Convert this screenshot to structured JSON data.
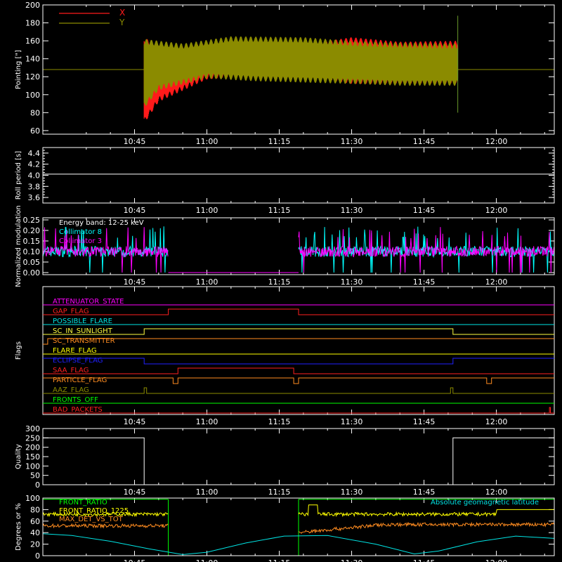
{
  "time_ticks": [
    "10:45",
    "11:00",
    "11:15",
    "11:30",
    "11:45",
    "12:00"
  ],
  "time_tick_minutes": [
    645,
    660,
    675,
    690,
    705,
    720
  ],
  "time_range_minutes": [
    626,
    732
  ],
  "chart_data": [
    {
      "id": "pointing",
      "type": "line",
      "ylabel": "Pointing [\"]",
      "ylim": [
        56,
        200
      ],
      "yticks": [
        60,
        80,
        100,
        120,
        140,
        160,
        180,
        200
      ],
      "legend_placement": "top-left",
      "series": [
        {
          "name": "X",
          "color": "#ff1a1a",
          "envelope_max": [
            [
              647,
              165
            ],
            [
              650,
              150
            ],
            [
              660,
              158
            ],
            [
              670,
              154
            ],
            [
              680,
              156
            ],
            [
              690,
              164
            ],
            [
              700,
              159
            ],
            [
              712,
              160
            ]
          ],
          "envelope_min": [
            [
              647,
              68
            ],
            [
              650,
              92
            ],
            [
              660,
              117
            ],
            [
              670,
              122
            ],
            [
              680,
              120
            ],
            [
              690,
              112
            ],
            [
              700,
              112
            ],
            [
              712,
              112
            ]
          ]
        },
        {
          "name": "Y",
          "color": "#8b8b00",
          "envelope_max": [
            [
              647,
              162
            ],
            [
              655,
              157
            ],
            [
              665,
              165
            ],
            [
              680,
              164
            ],
            [
              690,
              160
            ],
            [
              700,
              158
            ],
            [
              712,
              157
            ]
          ],
          "envelope_min": [
            [
              647,
              85
            ],
            [
              650,
              105
            ],
            [
              660,
              118
            ],
            [
              670,
              115
            ],
            [
              690,
              112
            ],
            [
              700,
              110
            ],
            [
              712,
              110
            ]
          ],
          "baseline": 128
        }
      ]
    },
    {
      "id": "roll",
      "type": "line",
      "ylabel": "Roll period [s]",
      "ylim": [
        3.5,
        4.5
      ],
      "yticks": [
        3.6,
        3.8,
        4.0,
        4.2,
        4.4
      ],
      "series": [
        {
          "color": "#ffffff",
          "values": [
            [
              626,
              4.02
            ],
            [
              732,
              4.02
            ]
          ]
        }
      ]
    },
    {
      "id": "modulation",
      "type": "line",
      "ylabel": "Normalized modulation",
      "ylim": [
        -0.01,
        0.26
      ],
      "yticks": [
        0.0,
        0.05,
        0.1,
        0.15,
        0.2,
        0.25
      ],
      "legend_title": "Energy band: 12-25 keV",
      "series": [
        {
          "name": "Collimator 8",
          "color": "#00ffff",
          "segments": [
            [
              626,
              652
            ],
            [
              679,
              732
            ]
          ],
          "level": 0.1
        },
        {
          "name": "Collimator 3",
          "color": "#ff00ff",
          "segments": [
            [
              626,
              652
            ],
            [
              679,
              732
            ]
          ],
          "level": 0.1
        }
      ]
    },
    {
      "id": "flags",
      "type": "line",
      "ylabel": "Flags",
      "flags": [
        {
          "name": "ATTENUATOR_STATE",
          "color": "#ff00ff",
          "steps": [
            [
              626,
              0
            ]
          ]
        },
        {
          "name": "GAP_FLAG",
          "color": "#ff2020",
          "steps": [
            [
              626,
              0
            ],
            [
              652,
              1
            ],
            [
              679,
              0
            ]
          ]
        },
        {
          "name": "POSSIBLE_FLARE",
          "color": "#00e5e5",
          "steps": [
            [
              626,
              0
            ]
          ]
        },
        {
          "name": "SC_IN_SUNLIGHT",
          "color": "#ffff40",
          "steps": [
            [
              626,
              0
            ],
            [
              647,
              1
            ],
            [
              711,
              0
            ]
          ]
        },
        {
          "name": "SC_TRANSMITTER",
          "color": "#ff8c20",
          "steps": [
            [
              626,
              0
            ],
            [
              627,
              1
            ]
          ]
        },
        {
          "name": "FLARE_FLAG",
          "color": "#ffff00",
          "steps": [
            [
              626,
              0
            ]
          ]
        },
        {
          "name": "ECLIPSE_FLAG",
          "color": "#2020ff",
          "steps": [
            [
              626,
              1
            ],
            [
              647,
              0
            ],
            [
              711,
              1
            ]
          ]
        },
        {
          "name": "SAA_FLAG",
          "color": "#ff2020",
          "steps": [
            [
              626,
              0
            ],
            [
              654,
              1
            ],
            [
              678,
              0
            ]
          ]
        },
        {
          "name": "PARTICLE_FLAG",
          "color": "#ff8c20",
          "steps": [
            [
              626,
              1
            ],
            [
              653,
              0
            ],
            [
              654,
              1
            ],
            [
              678,
              0
            ],
            [
              679,
              1
            ],
            [
              718,
              0
            ],
            [
              719,
              1
            ]
          ]
        },
        {
          "name": "AAZ_FLAG",
          "color": "#8b8b00",
          "steps": [
            [
              626,
              0
            ],
            [
              647,
              1
            ],
            [
              647.5,
              0
            ],
            [
              710.5,
              1
            ],
            [
              711,
              0
            ]
          ]
        },
        {
          "name": "FRONTS_OFF",
          "color": "#00ff00",
          "steps": [
            [
              626,
              0
            ]
          ]
        },
        {
          "name": "BAD_PACKETS",
          "color": "#ff2020",
          "steps": [
            [
              626,
              0
            ],
            [
              731,
              1
            ],
            [
              731.2,
              0
            ]
          ]
        }
      ]
    },
    {
      "id": "quality",
      "type": "line",
      "ylabel": "Quality",
      "ylim": [
        0,
        300
      ],
      "yticks": [
        0,
        50,
        100,
        150,
        200,
        250,
        300
      ],
      "series": [
        {
          "color": "#ffffff",
          "values": [
            [
              626,
              250
            ],
            [
              647,
              250
            ],
            [
              647,
              0
            ],
            [
              711,
              0
            ],
            [
              711,
              250
            ],
            [
              732,
              250
            ]
          ]
        }
      ]
    },
    {
      "id": "ratios",
      "type": "line",
      "ylabel": "Degrees or %",
      "ylim": [
        0,
        100
      ],
      "yticks": [
        0,
        20,
        40,
        60,
        80,
        100
      ],
      "series": [
        {
          "name": "FRONT_RATIO",
          "color": "#00ff00",
          "segments": [
            [
              626,
              652
            ],
            [
              679,
              732
            ]
          ],
          "level": 98
        },
        {
          "name": "FRONT_RATIO_1225",
          "color": "#ffff00",
          "segments": [
            [
              626,
              652
            ],
            [
              679,
              732
            ]
          ],
          "level": 72
        },
        {
          "name": "MAX_DET_VS_TOT",
          "color": "#ff8c20",
          "segments": [
            [
              626,
              652
            ],
            [
              679,
              732
            ]
          ],
          "level": 52
        },
        {
          "name": "Absolute geomagnetic latitude",
          "color": "#00e5e5",
          "values": [
            [
              626,
              38
            ],
            [
              632,
              35
            ],
            [
              640,
              25
            ],
            [
              648,
              12
            ],
            [
              655,
              2
            ],
            [
              660,
              6
            ],
            [
              668,
              22
            ],
            [
              676,
              34
            ],
            [
              685,
              35
            ],
            [
              695,
              20
            ],
            [
              703,
              3
            ],
            [
              708,
              8
            ],
            [
              716,
              24
            ],
            [
              724,
              34
            ],
            [
              732,
              30
            ]
          ]
        }
      ]
    }
  ]
}
